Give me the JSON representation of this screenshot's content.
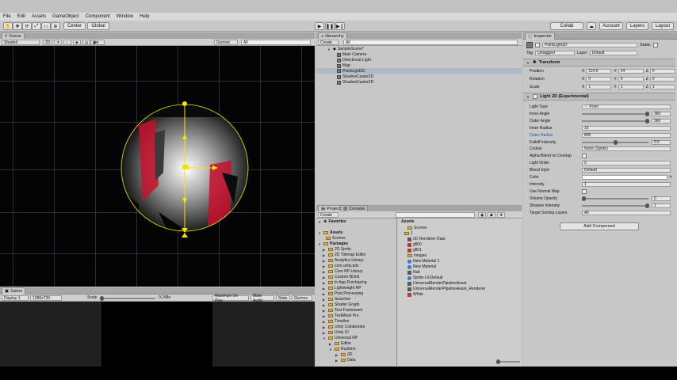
{
  "menu": [
    "File",
    "Edit",
    "Assets",
    "GameObject",
    "Component",
    "Window",
    "Help"
  ],
  "toolbar": {
    "center_label": "Center",
    "global_label": "Global",
    "collab_label": "Collab",
    "account_label": "Account",
    "layers_label": "Layers",
    "layout_label": "Layout"
  },
  "scene": {
    "tab_label": "Scene",
    "shading_mode": "Shaded",
    "mode_2d": "2D",
    "gizmos_label": "Gizmos",
    "search_placeholder": "All"
  },
  "game": {
    "tab_label": "Game",
    "display": "Display 1",
    "resolution": "1280x720",
    "scale_label": "Scale",
    "scale_value": "0.248x",
    "maximize_on_play": "Maximize On Play",
    "mute_audio": "Mute Audio",
    "stats": "Stats",
    "gizmos": "Gizmos"
  },
  "hierarchy": {
    "tab_label": "Hierarchy",
    "create_label": "Create",
    "search_placeholder": "All",
    "scene_name": "SampleScene*",
    "items": [
      "Main Camera",
      "Directional Light",
      "Map",
      "PointLight2D",
      "ShadowCaster2D",
      "ShadowCaster2D"
    ]
  },
  "project": {
    "tab_project": "Project",
    "tab_console": "Console",
    "create_label": "Create",
    "favorites_label": "Favorites",
    "assets_label": "Assets",
    "assets_sub": [
      "Scenes"
    ],
    "packages_label": "Packages",
    "packages": [
      "2D Sprite",
      "2D Tilemap Editor",
      "Analytics Library",
      "com.unity.ads",
      "Core RP Library",
      "Custom NUnit",
      "In App Purchasing",
      "Lightweight RP",
      "Post Processing",
      "Searcher",
      "Shader Graph",
      "Test Framework",
      "TextMesh Pro",
      "Timeline",
      "Unity Collaborate",
      "Unity UI",
      "Universal RP"
    ],
    "universal_children": [
      "Editor",
      "Runtime"
    ],
    "runtime_children": [
      "2D",
      "Data"
    ],
    "assets_header": "Assets",
    "assets_items": [
      "Scenes",
      "1",
      "2D Renderer Data",
      "gfl00",
      "gfl01",
      "images",
      "New Material 1",
      "New Material",
      "Null",
      "Sprite-Lit-Default",
      "UniversalRenderPipelineAsset",
      "UniversalRenderPipelineAsset_Renderer",
      "White"
    ]
  },
  "inspector": {
    "tab_label": "Inspector",
    "object_name": "PointLight2D",
    "static_label": "Static",
    "tag_label": "Tag",
    "tag_value": "Untagged",
    "layer_label": "Layer",
    "layer_value": "Default",
    "transform": {
      "title": "Transform",
      "position_label": "Position",
      "rotation_label": "Rotation",
      "scale_label": "Scale",
      "position": {
        "x": "114.5",
        "y": "24",
        "z": "0"
      },
      "rotation": {
        "x": "0",
        "y": "0",
        "z": "0"
      },
      "scale": {
        "x": "1",
        "y": "1",
        "z": "1"
      }
    },
    "light": {
      "title": "Light 2D (Experimental)",
      "rows": [
        {
          "label": "Light Type",
          "value": "Point",
          "kind": "dropdown"
        },
        {
          "label": "Inner Angle",
          "value": "360",
          "kind": "slider",
          "fill": 1.0
        },
        {
          "label": "Outer Angle",
          "value": "360",
          "kind": "slider",
          "fill": 1.0
        },
        {
          "label": "Inner Radius",
          "value": "15",
          "kind": "field"
        },
        {
          "label": "Outer Radius",
          "value": "800",
          "kind": "field"
        },
        {
          "label": "Falloff Intensity",
          "value": "0.5",
          "kind": "slider",
          "fill": 0.5
        },
        {
          "label": "Cookie",
          "value": "None (Sprite)",
          "kind": "field"
        },
        {
          "label": "Alpha Blend on Overlap",
          "value": "",
          "kind": "check"
        },
        {
          "label": "Light Order",
          "value": "0",
          "kind": "field"
        },
        {
          "label": "Blend Style",
          "value": "Default",
          "kind": "dropdown"
        },
        {
          "label": "Color",
          "value": "",
          "kind": "color"
        },
        {
          "label": "Intensity",
          "value": "1",
          "kind": "field"
        },
        {
          "label": "Use Normal Map",
          "value": "",
          "kind": "check"
        },
        {
          "label": "Volume Opacity",
          "value": "0",
          "kind": "slider",
          "fill": 0.0
        },
        {
          "label": "Shadow Intensity",
          "value": "1",
          "kind": "slider",
          "fill": 1.0
        },
        {
          "label": "Target Sorting Layers",
          "value": "All",
          "kind": "dropdown"
        }
      ]
    },
    "add_component_label": "Add Component"
  },
  "colors": {
    "light_red": "#c8102e",
    "gizmo_yellow": "#f2e600",
    "selection": "#aeb9c8"
  }
}
